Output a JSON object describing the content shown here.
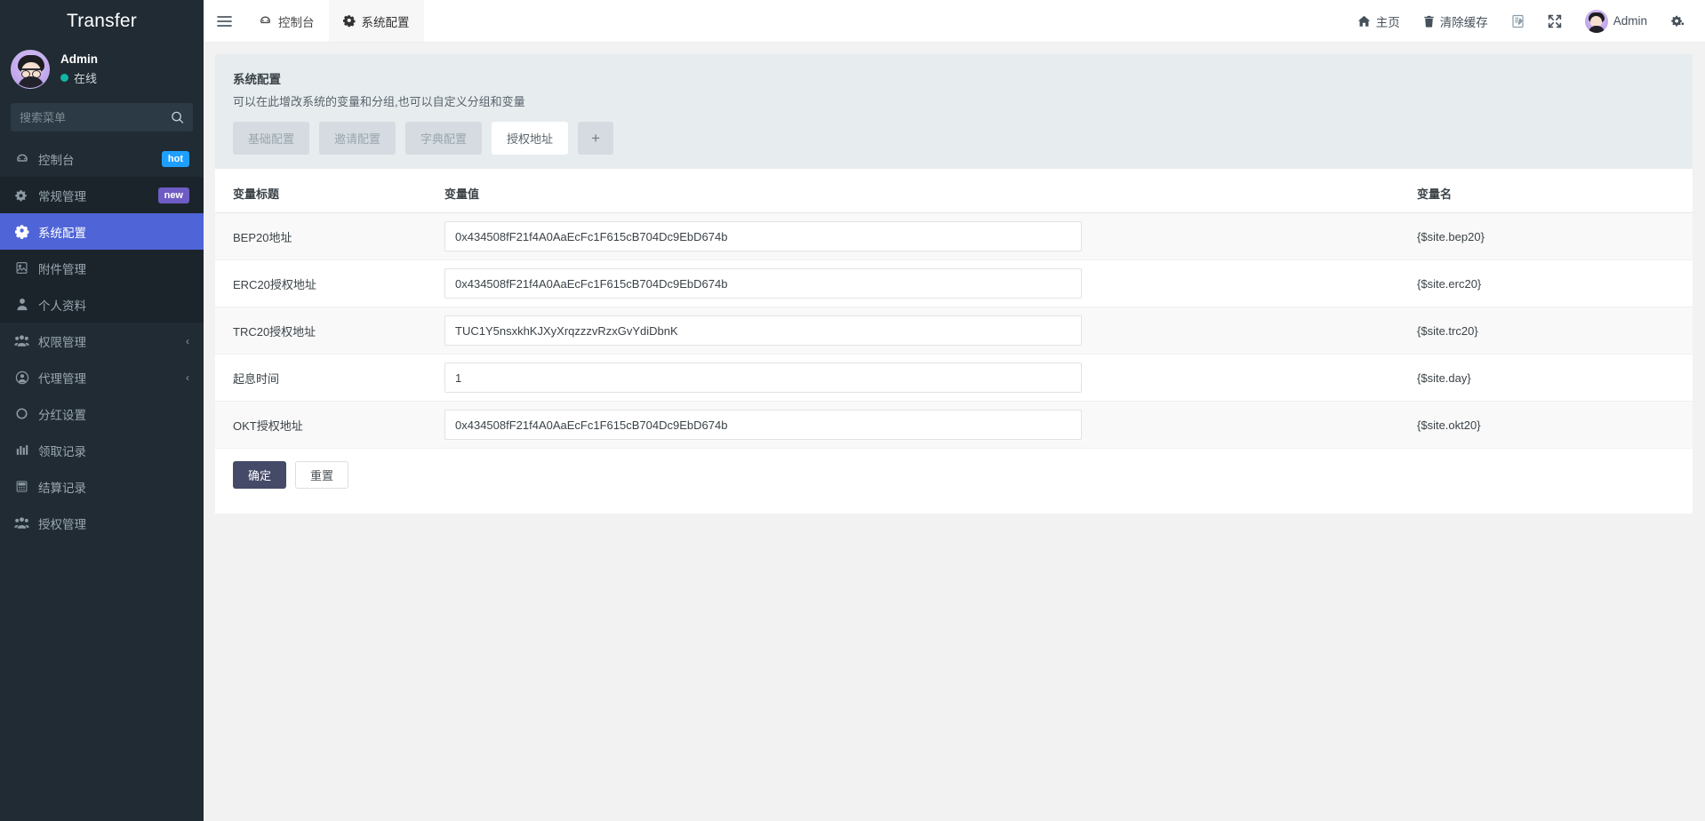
{
  "sidebar": {
    "brand": "Transfer",
    "profile": {
      "name": "Admin",
      "status": "在线"
    },
    "search": {
      "placeholder": "搜索菜单",
      "value": "",
      "icon": "search-icon"
    },
    "items": [
      {
        "label": "控制台",
        "icon": "dashboard-icon",
        "badge": "hot",
        "badge_type": "hot",
        "state": "normal"
      },
      {
        "label": "常规管理",
        "icon": "gears-icon",
        "badge": "new",
        "badge_type": "new",
        "state": "alt"
      },
      {
        "label": "系统配置",
        "icon": "gear-icon",
        "badge": "",
        "state": "active"
      },
      {
        "label": "附件管理",
        "icon": "image-file-icon",
        "badge": "",
        "state": "alt"
      },
      {
        "label": "个人资料",
        "icon": "user-icon",
        "badge": "",
        "state": "alt"
      },
      {
        "label": "权限管理",
        "icon": "users-icon",
        "badge": "",
        "state": "normal",
        "chevron": "‹"
      },
      {
        "label": "代理管理",
        "icon": "user-circle-icon",
        "badge": "",
        "state": "normal",
        "chevron": "‹"
      },
      {
        "label": "分红设置",
        "icon": "circle-icon",
        "badge": "",
        "state": "normal"
      },
      {
        "label": "领取记录",
        "icon": "chart-icon",
        "badge": "",
        "state": "normal"
      },
      {
        "label": "结算记录",
        "icon": "calculator-icon",
        "badge": "",
        "state": "normal"
      },
      {
        "label": "授权管理",
        "icon": "users-icon",
        "badge": "",
        "state": "normal"
      }
    ]
  },
  "topbar": {
    "menu_icon": "hamburger-icon",
    "tabs": [
      {
        "label": "控制台",
        "icon": "dashboard-icon",
        "selected": false
      },
      {
        "label": "系统配置",
        "icon": "gear-icon",
        "selected": true
      }
    ],
    "right": [
      {
        "label": "主页",
        "icon": "home-icon"
      },
      {
        "label": "清除缓存",
        "icon": "trash-icon"
      },
      {
        "label": "",
        "icon": "theme-icon"
      },
      {
        "label": "",
        "icon": "fullscreen-icon"
      },
      {
        "label": "Admin",
        "icon": "avatar-icon"
      },
      {
        "label": "",
        "icon": "settings-gear-icon"
      }
    ]
  },
  "panel": {
    "title": "系统配置",
    "subtitle": "可以在此增改系统的变量和分组,也可以自定义分组和变量",
    "tabs": [
      {
        "label": "基础配置",
        "active": false
      },
      {
        "label": "邀请配置",
        "active": false
      },
      {
        "label": "字典配置",
        "active": false
      },
      {
        "label": "授权地址",
        "active": true
      }
    ],
    "add_tab_label": "+",
    "table": {
      "headers": [
        "变量标题",
        "变量值",
        "变量名"
      ],
      "rows": [
        {
          "title": "BEP20地址",
          "value": "0x434508fF21f4A0AaEcFc1F615cB704Dc9EbD674b",
          "name": "{$site.bep20}"
        },
        {
          "title": "ERC20授权地址",
          "value": "0x434508fF21f4A0AaEcFc1F615cB704Dc9EbD674b",
          "name": "{$site.erc20}"
        },
        {
          "title": "TRC20授权地址",
          "value": "TUC1Y5nsxkhKJXyXrqzzzvRzxGvYdiDbnK",
          "name": "{$site.trc20}"
        },
        {
          "title": "起息时间",
          "value": "1",
          "name": "{$site.day}"
        },
        {
          "title": "OKT授权地址",
          "value": "0x434508fF21f4A0AaEcFc1F615cB704Dc9EbD674b",
          "name": "{$site.okt20}"
        }
      ]
    },
    "submit_label": "确定",
    "reset_label": "重置"
  },
  "colors": {
    "sidebar_bg": "#202B33",
    "active_menu": "#4e64d7",
    "badge_hot": "#1E9FFF",
    "badge_new": "#6e5cc4",
    "primary_button": "#454a68",
    "panel_head": "#e7ecef",
    "online_dot": "#13b5a5"
  }
}
